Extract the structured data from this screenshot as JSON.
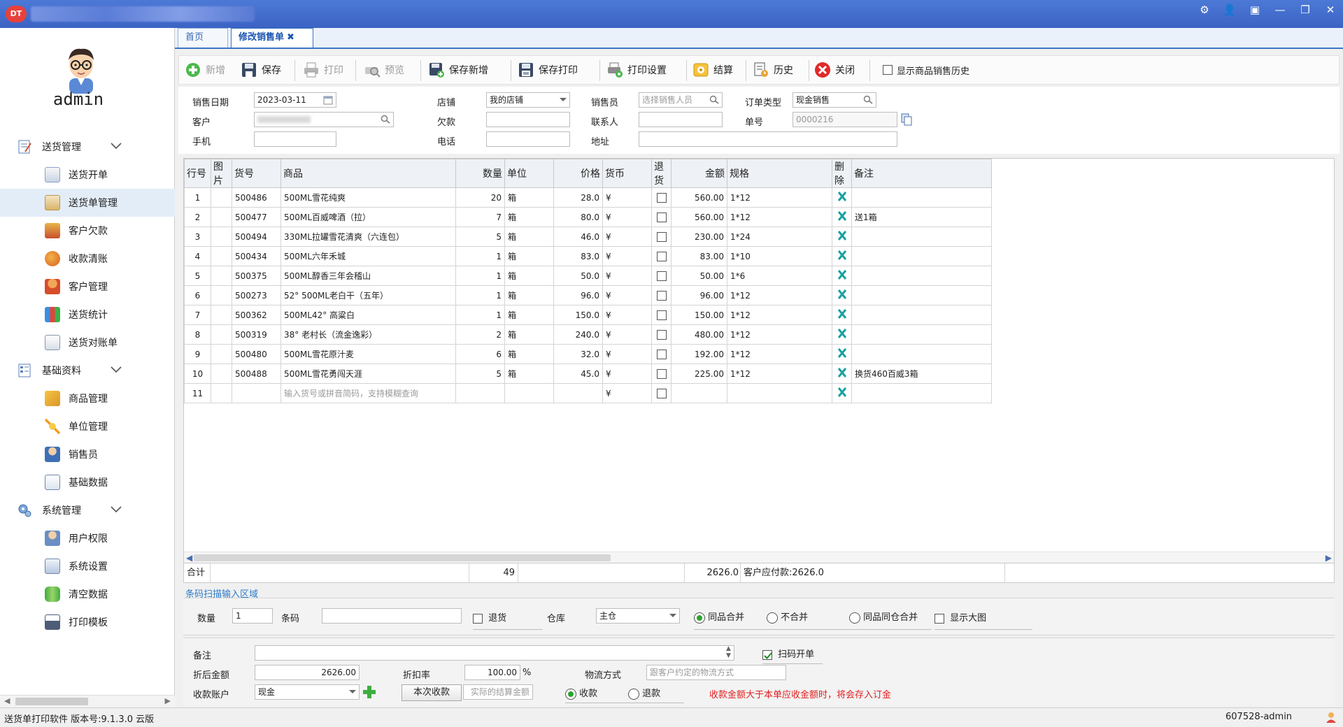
{
  "window": {
    "logo_text": "DT",
    "controls": [
      "⚙",
      "👤",
      "▣",
      "—",
      "❐",
      "✕"
    ]
  },
  "sidebar": {
    "user": "admin",
    "groups": [
      {
        "label": "送货管理",
        "icon": "delivery-icon",
        "items": [
          {
            "label": "送货开单",
            "icon": "form-icon"
          },
          {
            "label": "送货单管理",
            "icon": "list-icon",
            "active": true
          },
          {
            "label": "客户欠款",
            "icon": "debt-icon"
          },
          {
            "label": "收款清账",
            "icon": "payment-icon"
          },
          {
            "label": "客户管理",
            "icon": "customer-icon"
          },
          {
            "label": "送货统计",
            "icon": "stats-icon"
          },
          {
            "label": "送货对账单",
            "icon": "statement-icon"
          }
        ]
      },
      {
        "label": "基础资料",
        "icon": "base-data-icon",
        "items": [
          {
            "label": "商品管理",
            "icon": "goods-icon"
          },
          {
            "label": "单位管理",
            "icon": "unit-icon"
          },
          {
            "label": "销售员",
            "icon": "salesperson-icon"
          },
          {
            "label": "基础数据",
            "icon": "data-icon"
          }
        ]
      },
      {
        "label": "系统管理",
        "icon": "system-icon",
        "items": [
          {
            "label": "用户权限",
            "icon": "user-permission-icon"
          },
          {
            "label": "系统设置",
            "icon": "settings-icon"
          },
          {
            "label": "清空数据",
            "icon": "clear-data-icon"
          },
          {
            "label": "打印模板",
            "icon": "printer-icon"
          }
        ]
      }
    ]
  },
  "tabs": [
    {
      "label": "首页",
      "active": false
    },
    {
      "label": "修改销售单",
      "active": true,
      "close": "✖"
    }
  ],
  "toolbar": {
    "new": "新增",
    "save": "保存",
    "print": "打印",
    "preview": "预览",
    "save_new": "保存新增",
    "save_print": "保存打印",
    "print_settings": "打印设置",
    "settle": "结算",
    "history": "历史",
    "close": "关闭",
    "show_history": "显示商品销售历史"
  },
  "form": {
    "sale_date_label": "销售日期",
    "sale_date": "2023-03-11",
    "store_label": "店铺",
    "store": "我的店铺",
    "salesperson_label": "销售员",
    "salesperson_placeholder": "选择销售人员",
    "order_type_label": "订单类型",
    "order_type": "现金销售",
    "customer_label": "客户",
    "customer": "",
    "owed_label": "欠款",
    "owed": "",
    "contact_label": "联系人",
    "contact": "",
    "order_no_label": "单号",
    "order_no": "0000216",
    "phone_label": "手机",
    "phone": "",
    "tel_label": "电话",
    "tel": "",
    "address_label": "地址",
    "address": ""
  },
  "grid": {
    "headers": [
      "行号",
      "图片",
      "货号",
      "商品",
      "数量",
      "单位",
      "价格",
      "货币",
      "退货",
      "金额",
      "规格",
      "删除",
      "备注"
    ],
    "rows": [
      {
        "no": "1",
        "code": "500486",
        "name": "500ML雪花纯爽",
        "qty": "20",
        "unit": "箱",
        "price": "28.0",
        "cur": "¥",
        "amount": "560.00",
        "spec": "1*12",
        "note": ""
      },
      {
        "no": "2",
        "code": "500477",
        "name": "500ML百威啤酒（拉）",
        "qty": "7",
        "unit": "箱",
        "price": "80.0",
        "cur": "¥",
        "amount": "560.00",
        "spec": "1*12",
        "note": "送1箱"
      },
      {
        "no": "3",
        "code": "500494",
        "name": "330ML拉罐雪花清爽（六连包）",
        "qty": "5",
        "unit": "箱",
        "price": "46.0",
        "cur": "¥",
        "amount": "230.00",
        "spec": "1*24",
        "note": ""
      },
      {
        "no": "4",
        "code": "500434",
        "name": "500ML六年禾城",
        "qty": "1",
        "unit": "箱",
        "price": "83.0",
        "cur": "¥",
        "amount": "83.00",
        "spec": "1*10",
        "note": ""
      },
      {
        "no": "5",
        "code": "500375",
        "name": "500ML醇香三年会稽山",
        "qty": "1",
        "unit": "箱",
        "price": "50.0",
        "cur": "¥",
        "amount": "50.00",
        "spec": "1*6",
        "note": ""
      },
      {
        "no": "6",
        "code": "500273",
        "name": "52° 500ML老白干（五年）",
        "qty": "1",
        "unit": "箱",
        "price": "96.0",
        "cur": "¥",
        "amount": "96.00",
        "spec": "1*12",
        "note": ""
      },
      {
        "no": "7",
        "code": "500362",
        "name": "500ML42° 高粱白",
        "qty": "1",
        "unit": "箱",
        "price": "150.0",
        "cur": "¥",
        "amount": "150.00",
        "spec": "1*12",
        "note": ""
      },
      {
        "no": "8",
        "code": "500319",
        "name": "38° 老村长（流金逸彩）",
        "qty": "2",
        "unit": "箱",
        "price": "240.0",
        "cur": "¥",
        "amount": "480.00",
        "spec": "1*12",
        "note": ""
      },
      {
        "no": "9",
        "code": "500480",
        "name": "500ML雪花原汁麦",
        "qty": "6",
        "unit": "箱",
        "price": "32.0",
        "cur": "¥",
        "amount": "192.00",
        "spec": "1*12",
        "note": ""
      },
      {
        "no": "10",
        "code": "500488",
        "name": "500ML雪花勇闯天涯",
        "qty": "5",
        "unit": "箱",
        "price": "45.0",
        "cur": "¥",
        "amount": "225.00",
        "spec": "1*12",
        "note": "换货460百威3箱"
      },
      {
        "no": "11",
        "code": "",
        "name": "输入货号或拼音简码，支持模糊查询",
        "qty": "",
        "unit": "",
        "price": "",
        "cur": "¥",
        "amount": "",
        "spec": "",
        "note": "",
        "placeholder": true
      }
    ],
    "summary": {
      "label": "合计",
      "qty": "49",
      "amount": "2626.0",
      "payable": "客户应付款:2626.0"
    }
  },
  "scan": {
    "title": "条码扫描输入区域",
    "qty_label": "数量",
    "qty": "1",
    "barcode_label": "条码",
    "barcode": "",
    "return_label": "退货",
    "warehouse_label": "仓库",
    "warehouse": "主仓",
    "merge_same": "同品合并",
    "no_merge": "不合并",
    "merge_same_wh": "同品同仓合并",
    "show_big": "显示大图"
  },
  "bottom": {
    "note_label": "备注",
    "note": "",
    "scan_order": "扫码开单",
    "after_discount_label": "折后金额",
    "after_discount": "2626.00",
    "discount_rate_label": "折扣率",
    "discount_rate": "100.00",
    "percent": "%",
    "logistics_label": "物流方式",
    "logistics_placeholder": "跟客户约定的物流方式",
    "account_label": "收款账户",
    "account": "现金",
    "collect_button": "本次收款",
    "actual_placeholder": "实际的结算金额",
    "collect_radio": "收款",
    "refund_radio": "退款",
    "warning": "收款金额大于本单应收金额时，将会存入订金"
  },
  "status": {
    "left": "送货单打印软件 版本号:9.1.3.0 云版",
    "right": "607528-admin"
  },
  "colors": {
    "accent": "#3a75c4",
    "warning": "#e02020",
    "delete": "#1aa0a0",
    "radio_on": "#2aa52a"
  }
}
